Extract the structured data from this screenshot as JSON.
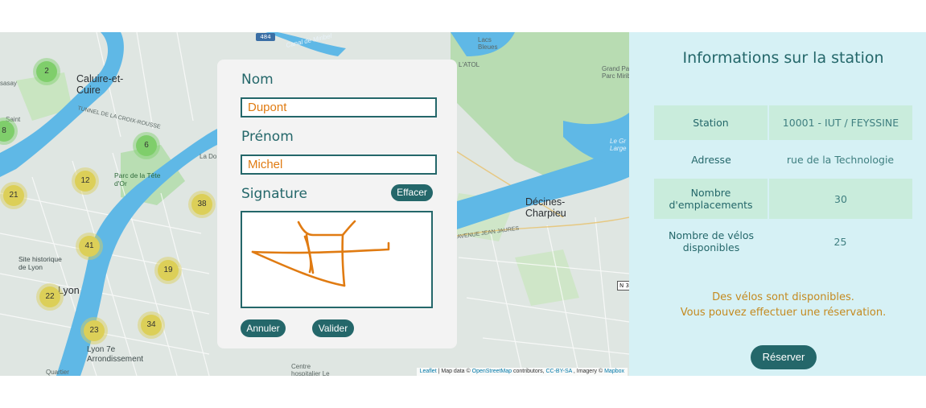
{
  "map": {
    "clusters": [
      {
        "count": "2",
        "color": "green"
      },
      {
        "count": "8",
        "color": "green"
      },
      {
        "count": "6",
        "color": "green"
      },
      {
        "count": "12",
        "color": "yellow"
      },
      {
        "count": "21",
        "color": "yellow"
      },
      {
        "count": "38",
        "color": "yellow"
      },
      {
        "count": "41",
        "color": "yellow"
      },
      {
        "count": "19",
        "color": "yellow"
      },
      {
        "count": "22",
        "color": "yellow"
      },
      {
        "count": "23",
        "color": "yellow"
      },
      {
        "count": "34",
        "color": "yellow"
      }
    ],
    "labels": {
      "caluire": "Caluire-et-\nCuire",
      "decines": "Décines-\nCharpieu",
      "lyon": "Lyon",
      "lyon7": "Lyon 7e\nArrondissement",
      "parc": "Parc de la Tête\nd'Or",
      "site": "Site historique\nde Lyon",
      "grand_parc": "Grand Pa\nParc Miribel-J",
      "lacs": "Lacs\nBleues",
      "grand_large": "Le Gr\nLarge",
      "canal": "Canal de Miribel",
      "tunnel": "TUNNEL DE LA CROIX-ROUSSE",
      "avenue": "AVENUE JEAN JAURES",
      "latol": "L'ATOL",
      "saint": "Saint",
      "sasay": "sasay",
      "lado": "La Do",
      "centre": "Centre\nhospitalier Le",
      "quartier": "Quartier"
    },
    "shields": {
      "a484": "484",
      "n3": "N 3"
    },
    "attribution": {
      "leaflet": "Leaflet",
      "mapdata": "| Map data ©",
      "osm": "OpenStreetMap",
      "contributors": "contributors,",
      "ccbysa": "CC-BY-SA",
      "imagery": ", Imagery ©",
      "mapbox": "Mapbox"
    }
  },
  "modal": {
    "nom_label": "Nom",
    "nom_value": "Dupont",
    "prenom_label": "Prénom",
    "prenom_value": "Michel",
    "signature_label": "Signature",
    "effacer_button": "Effacer",
    "annuler_button": "Annuler",
    "valider_button": "Valider",
    "signature_color": "#e07b12"
  },
  "panel": {
    "title": "Informations sur la station",
    "rows": [
      {
        "key": "Station",
        "value": "10001 - IUT / FEYSSINE"
      },
      {
        "key": "Adresse",
        "value": "rue de la Technologie"
      },
      {
        "key": "Nombre d'emplacements",
        "value": "30"
      },
      {
        "key": "Nombre de vélos disponibles",
        "value": "25"
      }
    ],
    "availability_line1": "Des vélos sont disponibles.",
    "availability_line2": "Vous pouvez effectuer une réservation.",
    "reserve_button": "Réserver"
  },
  "colors": {
    "accent": "#24676a",
    "panel_bg": "#d6f1f5",
    "orange": "#e07b12",
    "availability_text": "#c48a20",
    "river": "#5fb8e6"
  }
}
